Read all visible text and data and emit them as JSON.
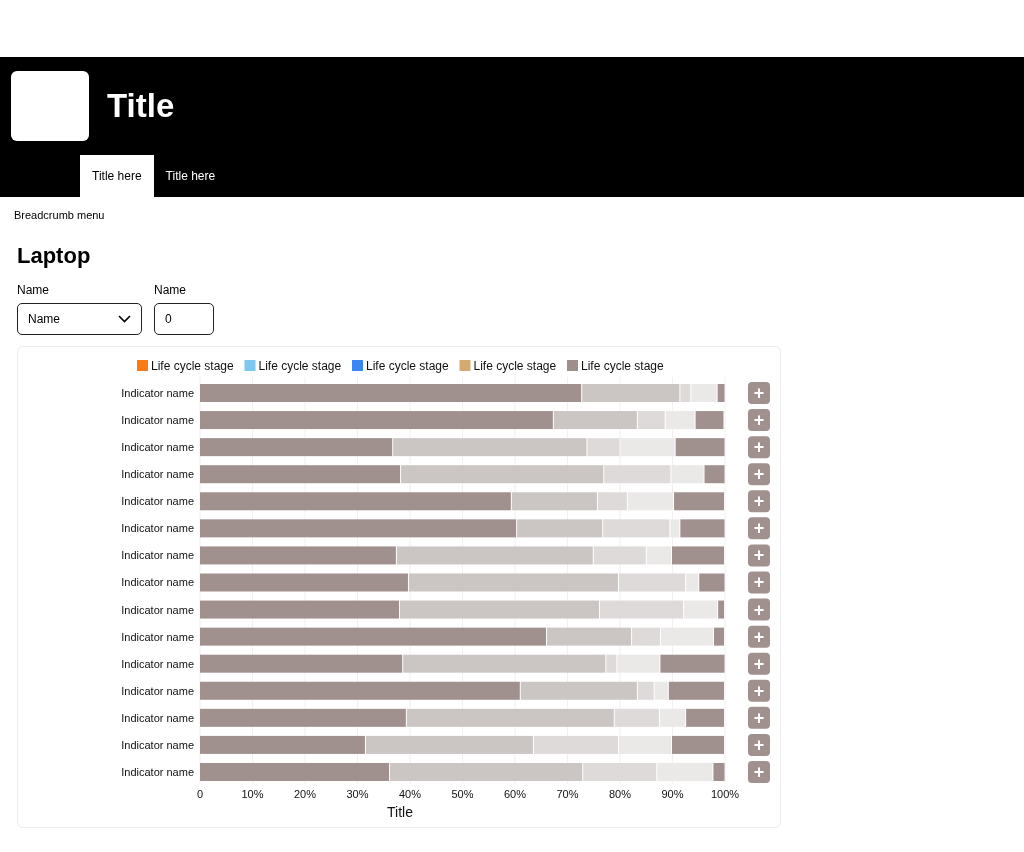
{
  "header": {
    "title": "Title",
    "tabs": [
      {
        "label": "Title here",
        "selected": true
      },
      {
        "label": "Title here",
        "selected": false
      }
    ]
  },
  "breadcrumb": "Breadcrumb menu",
  "page_title": "Laptop",
  "filters": [
    {
      "kind": "select",
      "label": "Name",
      "value": "Name"
    },
    {
      "kind": "input",
      "label": "Name",
      "value": "0"
    }
  ],
  "chart": {
    "legend": [
      {
        "label": "Life cycle stage",
        "color": "#fa7a14"
      },
      {
        "label": "Life cycle stage",
        "color": "#7dc8ef"
      },
      {
        "label": "Life cycle stage",
        "color": "#3b86f0"
      },
      {
        "label": "Life cycle stage",
        "color": "#d4aa6e"
      },
      {
        "label": "Life cycle stage",
        "color": "#9e8f8c"
      }
    ],
    "row_action": "+",
    "chart_data": {
      "type": "bar",
      "orientation": "horizontal",
      "stacked": true,
      "grid": true,
      "xlabel": "Title",
      "xlim": [
        0,
        100
      ],
      "xticks": [
        {
          "value": 0,
          "label": "0"
        },
        {
          "value": 10,
          "label": "10%"
        },
        {
          "value": 20,
          "label": "20%"
        },
        {
          "value": 30,
          "label": "30%"
        },
        {
          "value": 40,
          "label": "40%"
        },
        {
          "value": 50,
          "label": "50%"
        },
        {
          "value": 60,
          "label": "60%"
        },
        {
          "value": 70,
          "label": "70%"
        },
        {
          "value": 80,
          "label": "80%"
        },
        {
          "value": 90,
          "label": "90%"
        },
        {
          "value": 100,
          "label": "100%"
        }
      ],
      "categories": [
        "Indicator name",
        "Indicator name",
        "Indicator name",
        "Indicator name",
        "Indicator name",
        "Indicator name",
        "Indicator name",
        "Indicator name",
        "Indicator name",
        "Indicator name",
        "Indicator name",
        "Indicator name",
        "Indicator name",
        "Indicator name",
        "Indicator name"
      ],
      "series": [
        {
          "color": "#a0908e",
          "values": [
            72.8,
            67.4,
            36.8,
            38.3,
            59.4,
            60.4,
            37.5,
            39.8,
            38.1,
            66.1,
            38.7,
            61.1,
            39.4,
            31.6,
            36.2
          ]
        },
        {
          "color": "#cbc6c4",
          "values": [
            18.7,
            16.0,
            37.0,
            38.7,
            16.4,
            16.4,
            37.5,
            40.0,
            38.1,
            16.2,
            38.7,
            22.3,
            39.6,
            32.0,
            36.8
          ]
        },
        {
          "color": "#dedad9",
          "values": [
            2.1,
            5.3,
            6.3,
            12.8,
            5.7,
            12.8,
            10.1,
            12.8,
            16.0,
            5.5,
            2.1,
            3.2,
            8.6,
            16.2,
            14.1
          ]
        },
        {
          "color": "#ebe8e8",
          "values": [
            5.0,
            5.7,
            10.5,
            6.3,
            8.8,
            1.9,
            4.8,
            2.5,
            6.5,
            10.1,
            8.2,
            2.7,
            5.0,
            10.1,
            10.7
          ]
        },
        {
          "color": "#a0908e",
          "values": [
            1.5,
            5.5,
            9.5,
            4.0,
            9.7,
            8.6,
            10.1,
            5.0,
            1.3,
            2.1,
            12.4,
            10.7,
            7.4,
            10.1,
            2.3
          ]
        }
      ]
    }
  }
}
